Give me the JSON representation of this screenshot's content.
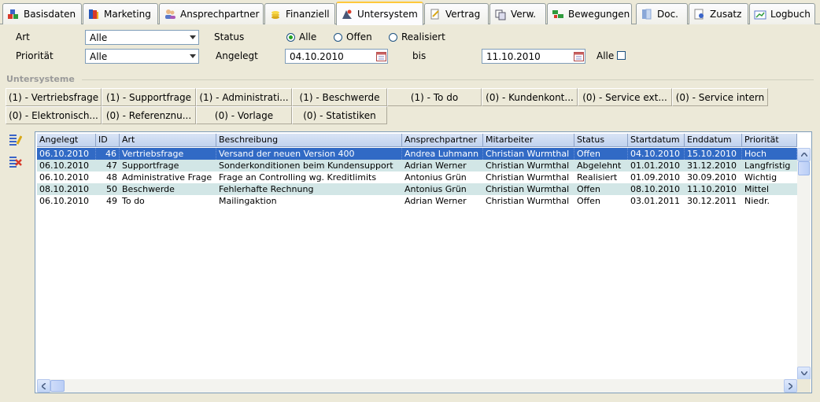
{
  "tabs": [
    {
      "label": "Basisdaten",
      "icon": "cubes-icon"
    },
    {
      "label": "Marketing",
      "icon": "book-icon"
    },
    {
      "label": "Ansprechpartner",
      "icon": "contacts-icon"
    },
    {
      "label": "Finanziell",
      "icon": "coins-icon"
    },
    {
      "label": "Untersystem",
      "icon": "subsystem-icon"
    },
    {
      "label": "Vertrag",
      "icon": "contract-icon"
    },
    {
      "label": "Verw.",
      "icon": "links-icon"
    },
    {
      "label": "Bewegungen",
      "icon": "movements-icon"
    },
    {
      "label": "Doc.",
      "icon": "document-icon"
    },
    {
      "label": "Zusatz",
      "icon": "extra-icon"
    },
    {
      "label": "Logbuch",
      "icon": "logbook-icon"
    }
  ],
  "filters": {
    "art_label": "Art",
    "art_value": "Alle",
    "prioritaet_label": "Priorität",
    "prioritaet_value": "Alle",
    "status_label": "Status",
    "status_options": [
      {
        "label": "Alle",
        "selected": true
      },
      {
        "label": "Offen",
        "selected": false
      },
      {
        "label": "Realisiert",
        "selected": false
      }
    ],
    "angelegt_label": "Angelegt",
    "angelegt_from": "04.10.2010",
    "bis_label": "bis",
    "angelegt_to": "11.10.2010",
    "alle_label": "Alle",
    "alle_checked": false
  },
  "group_title": "Untersysteme",
  "subsystem_buttons": [
    "(1) - Vertriebsfrage",
    "(1) - Supportfrage",
    "(1) - Administrati...",
    "(1) - Beschwerde",
    "(1) - To do",
    "(0) - Kundenkont...",
    "(0) - Service ext...",
    "(0) - Service intern",
    "(0) - Elektronisch...",
    "(0) - Referenznu...",
    "(0) - Vorlage",
    "(0) - Statistiken"
  ],
  "side_icons": [
    "edit-list-icon",
    "delete-list-icon"
  ],
  "table": {
    "columns": [
      "Angelegt",
      "ID",
      "Art",
      "Beschreibung",
      "Ansprechpartner",
      "Mitarbeiter",
      "Status",
      "Startdatum",
      "Enddatum",
      "Priorität"
    ],
    "rows": [
      [
        "06.10.2010",
        "46",
        "Vertriebsfrage",
        "Versand der neuen Version 400",
        "Andrea Luhmann",
        "Christian Wurmthal",
        "Offen",
        "04.10.2010",
        "15.10.2010",
        "Hoch"
      ],
      [
        "06.10.2010",
        "47",
        "Supportfrage",
        "Sonderkonditionen beim Kundensupport",
        "Adrian Werner",
        "Christian Wurmthal",
        "Abgelehnt",
        "01.01.2010",
        "31.12.2010",
        "Langfristig"
      ],
      [
        "06.10.2010",
        "48",
        "Administrative Frage",
        "Frage an Controlling wg. Kreditlimits",
        "Antonius Grün",
        "Christian Wurmthal",
        "Realisiert",
        "01.09.2010",
        "30.09.2010",
        "Wichtig"
      ],
      [
        "08.10.2010",
        "50",
        "Beschwerde",
        "Fehlerhafte Rechnung",
        "Antonius Grün",
        "Christian Wurmthal",
        "Offen",
        "08.10.2010",
        "11.10.2010",
        "Mittel"
      ],
      [
        "06.10.2010",
        "49",
        "To do",
        "Mailingaktion",
        "Adrian Werner",
        "Christian Wurmthal",
        "Offen",
        "03.01.2011",
        "30.12.2011",
        "Niedr."
      ]
    ],
    "selected_row": 0
  },
  "colors": {
    "selection": "#316ac5",
    "alt_row": "#d2e6e6",
    "active_tab_accent": "#ffc83c"
  }
}
